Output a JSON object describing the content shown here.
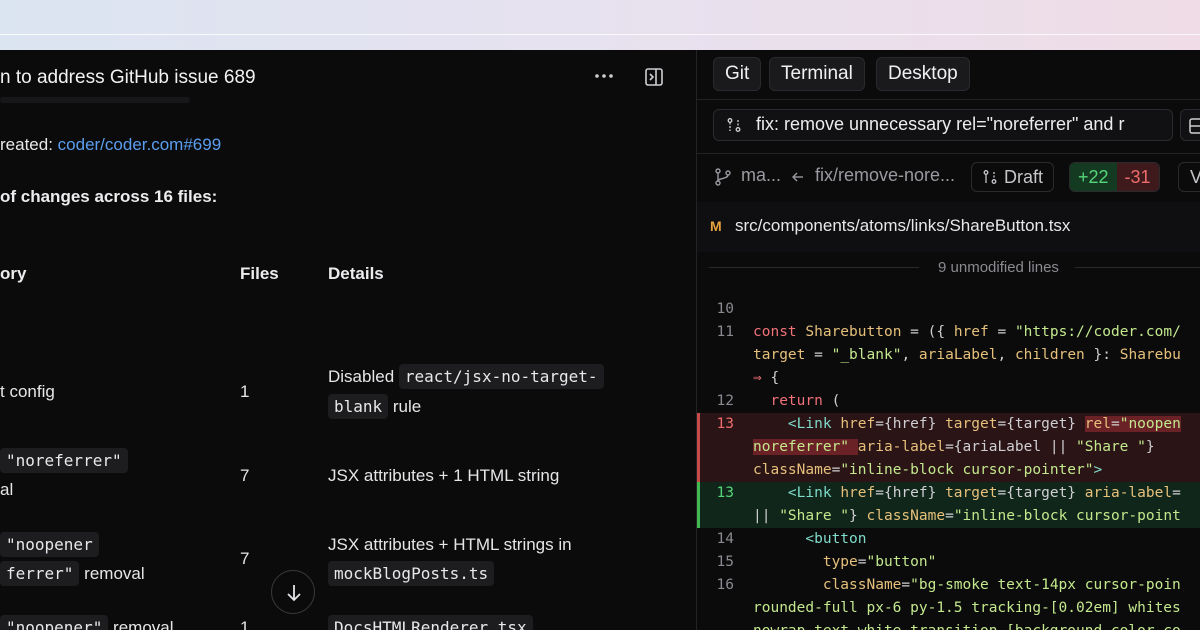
{
  "chat": {
    "title_fragment": "n to address GitHub issue 689",
    "created_prefix": "reated: ",
    "created_link": "coder/coder.com#699",
    "summary": "of changes across 16 files:",
    "headers": [
      "ory",
      "Files",
      "Details"
    ],
    "rows": [
      {
        "category": [
          "t config"
        ],
        "files": "1",
        "details": [
          "Disabled ",
          "react/jsx-no-target-",
          "blank",
          " rule"
        ]
      },
      {
        "category": [
          "\"noreferrer\"",
          "al"
        ],
        "files": "7",
        "details": [
          "JSX attributes + 1 HTML string"
        ]
      },
      {
        "category": [
          "\"noopener",
          "ferrer\"",
          " removal"
        ],
        "files": "7",
        "details": [
          "JSX attributes + HTML strings in",
          "mockBlogPosts.ts"
        ]
      },
      {
        "category": [
          "\"noopener\"",
          " removal"
        ],
        "files": "1",
        "details": [
          "DocsHTMLRenderer.tsx"
        ]
      }
    ]
  },
  "tabs": [
    "Git",
    "Terminal",
    "Desktop"
  ],
  "pr": {
    "title": "fix: remove unnecessary rel=\"noreferrer\" and r",
    "base_branch": "ma...",
    "head_branch": "fix/remove-nore...",
    "status": "Draft",
    "additions": "+22",
    "deletions": "-31",
    "view_label": "V"
  },
  "file": {
    "status": "M",
    "path": "src/components/atoms/links/ShareButton.tsx",
    "unmodified": "9 unmodified lines"
  },
  "code_lines": [
    {
      "num": "10",
      "type": "ctx"
    },
    {
      "num": "11",
      "type": "ctx"
    },
    {
      "num": "",
      "type": "ctx"
    },
    {
      "num": "",
      "type": "ctx"
    },
    {
      "num": "12",
      "type": "ctx"
    },
    {
      "num": "13",
      "type": "del"
    },
    {
      "num": "",
      "type": "del"
    },
    {
      "num": "",
      "type": "del"
    },
    {
      "num": "13",
      "type": "add"
    },
    {
      "num": "",
      "type": "add"
    },
    {
      "num": "14",
      "type": "ctx"
    },
    {
      "num": "15",
      "type": "ctx"
    },
    {
      "num": "16",
      "type": "ctx"
    },
    {
      "num": "",
      "type": "ctx"
    },
    {
      "num": "",
      "type": "ctx"
    }
  ],
  "colors": {
    "link": "#5b9ef0",
    "add": "#55d67a",
    "del": "#f06c6c",
    "modified": "#e6a23c"
  }
}
